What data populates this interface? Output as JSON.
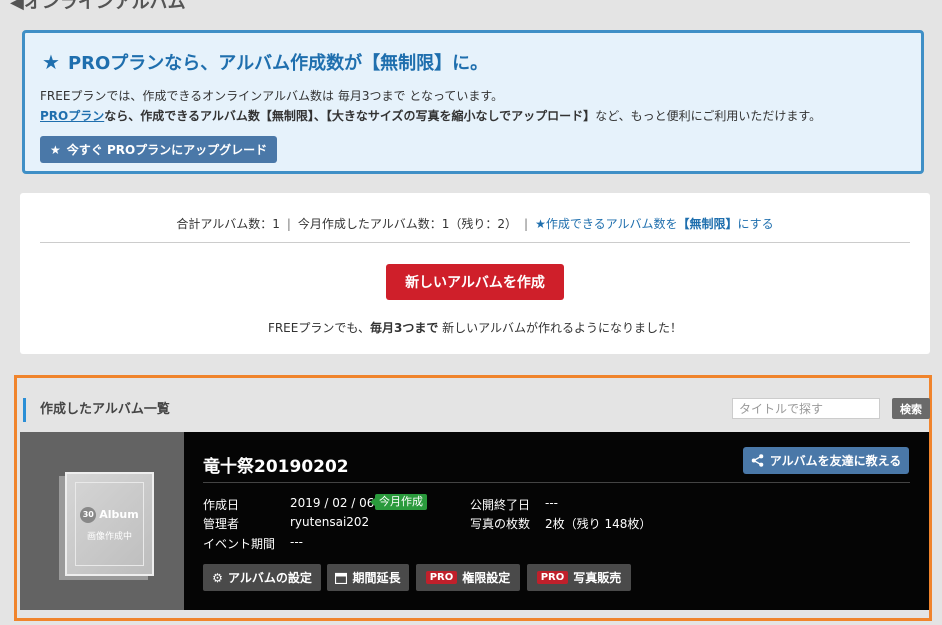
{
  "header": {
    "title": "オンラインアルバム"
  },
  "pro_banner": {
    "title": "PROプランなら、アルバム作成数が【無制限】に。",
    "line1": "FREEプランでは、作成できるオンラインアルバム数は 毎月3つまで となっています。",
    "line2_link": "PROプラン",
    "line2_bold": "なら、作成できるアルバム数【無制限】、【大きなサイズの写真を縮小なしでアップロード】",
    "line2_rest": "など、もっと便利にご利用いただけます。",
    "upgrade_label": "今すぐ PROプランにアップグレード"
  },
  "summary": {
    "total": "合計アルバム数：1",
    "this_month": "今月作成したアルバム数：1（残り：2）",
    "unlimited_link_pre": "作成できるアルバム数を",
    "unlimited_link_bold": "【無制限】",
    "unlimited_link_post": "にする",
    "create_label": "新しいアルバムを作成",
    "note_pre": "FREEプランでも、",
    "note_bold": "毎月3つまで",
    "note_post": " 新しいアルバムが作れるようになりました！"
  },
  "album_list": {
    "heading": "作成したアルバム一覧",
    "search_placeholder": "タイトルで探す",
    "search_label": "検索",
    "albums": [
      {
        "thumb_badge": "30",
        "thumb_logo": "Album",
        "thumb_status": "画像作成中",
        "title": "竜十祭20190202",
        "share_label": "アルバムを友達に教える",
        "created_label": "作成日",
        "created_value": "2019 / 02 / 06",
        "today_badge": "今月作成",
        "manager_label": "管理者",
        "manager_value": "ryutensai202",
        "event_label": "イベント期間",
        "event_value": "---",
        "public_end_label": "公開終了日",
        "public_end_value": "---",
        "photo_count_label": "写真の枚数",
        "photo_count_value": "2枚（残り 148枚）",
        "buttons": {
          "settings": "アルバムの設定",
          "extend": "期間延長",
          "pro_tag": "PRO",
          "permissions": "権限設定",
          "sales": "写真販売"
        }
      }
    ]
  },
  "colors": {
    "accent_blue": "#1f6fae",
    "create_red": "#cf1f2a",
    "highlight_orange": "#f0842c",
    "today_green": "#2a9a3c"
  }
}
